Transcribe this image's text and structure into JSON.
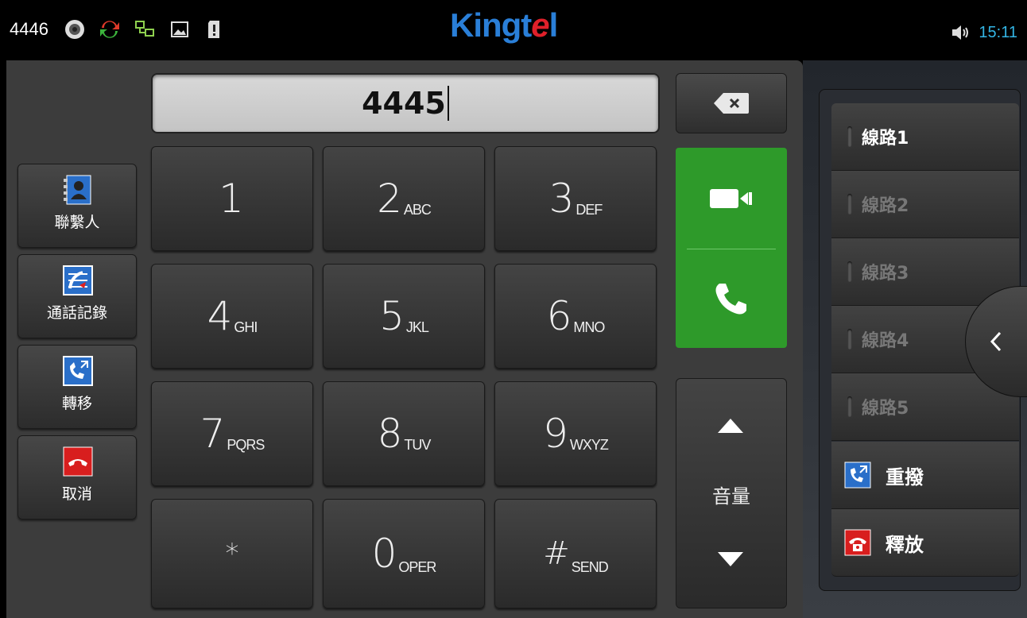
{
  "statusbar": {
    "line_number": "4446",
    "brand": {
      "prefix": "Kingt",
      "accent": "e",
      "suffix": "l",
      "color": "#2a7fd8",
      "accent_color": "#e0202a"
    },
    "time": "15:11",
    "icons": [
      "speaker-icon",
      "sync-icon",
      "network-icon",
      "image-icon",
      "sdcard-icon",
      "volume-icon"
    ]
  },
  "dialer": {
    "input_value": "4445",
    "keys": [
      {
        "digit": "1",
        "sub": ""
      },
      {
        "digit": "2",
        "sub": "ABC"
      },
      {
        "digit": "3",
        "sub": "DEF"
      },
      {
        "digit": "4",
        "sub": "GHI"
      },
      {
        "digit": "5",
        "sub": "JKL"
      },
      {
        "digit": "6",
        "sub": "MNO"
      },
      {
        "digit": "7",
        "sub": "PQRS"
      },
      {
        "digit": "8",
        "sub": "TUV"
      },
      {
        "digit": "9",
        "sub": "WXYZ"
      },
      {
        "digit": "*",
        "sub": ""
      },
      {
        "digit": "0",
        "sub": "OPER"
      },
      {
        "digit": "#",
        "sub": "SEND"
      }
    ],
    "volume_label": "音量",
    "call_color": "#2e9a2a"
  },
  "sidebar": {
    "contacts": "聯繫人",
    "call_log": "通話記錄",
    "transfer": "轉移",
    "cancel": "取消"
  },
  "lines": {
    "items": [
      "線路1",
      "線路2",
      "線路3",
      "線路4",
      "線路5"
    ],
    "redial": "重撥",
    "release": "釋放"
  }
}
